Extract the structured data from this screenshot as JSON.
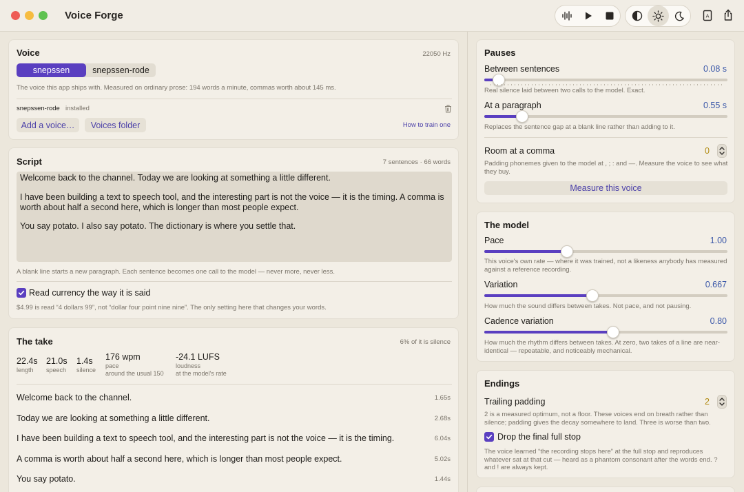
{
  "app": {
    "title": "Voice Forge"
  },
  "toolbar": {
    "icons": [
      "waveform-icon",
      "play-icon",
      "stop-icon",
      "contrast-icon",
      "sun-icon",
      "moon-icon",
      "book-icon",
      "share-icon"
    ]
  },
  "voice": {
    "heading": "Voice",
    "sample_rate": "22050 Hz",
    "options": [
      "snepssen",
      "snepssen-rode"
    ],
    "selected": "snepssen",
    "caption": "The voice this app ships with. Measured on ordinary prose: 194 words a minute, commas worth about 145 ms.",
    "installed_name": "snepssen-rode",
    "installed_status": "installed",
    "add_label": "Add a voice…",
    "folder_label": "Voices folder",
    "train_link": "How to train one"
  },
  "script": {
    "heading": "Script",
    "meta": "7 sentences · 66 words",
    "paragraphs": [
      "Welcome back to the channel. Today we are looking at something a little different.",
      "I have been building a text to speech tool, and the interesting part is not the voice — it is the timing. A comma is worth about half a second here, which is longer than most people expect.",
      "You say potato. I also say potato. The dictionary is where you settle that."
    ],
    "caption": "A blank line starts a new paragraph. Each sentence becomes one call to the model — never more, never less.",
    "currency_label": "Read currency the way it is said",
    "currency_checked": true,
    "currency_caption": "$4.99 is read “4 dollars 99”, not “dollar four point nine nine”. The only setting here that changes your words."
  },
  "take": {
    "heading": "The take",
    "meta": "6% of it is silence",
    "stats": [
      {
        "value": "22.4s",
        "label": "length",
        "sub": ""
      },
      {
        "value": "21.0s",
        "label": "speech",
        "sub": ""
      },
      {
        "value": "1.4s",
        "label": "silence",
        "sub": ""
      },
      {
        "value": "176 wpm",
        "label": "pace",
        "sub": "around the usual 150"
      },
      {
        "value": "-24.1 LUFS",
        "label": "loudness",
        "sub": "at the model's rate"
      }
    ],
    "sentences": [
      {
        "text": "Welcome back to the channel.",
        "dur": "1.65s"
      },
      {
        "text": "Today we are looking at something a little different.",
        "dur": "2.68s"
      },
      {
        "text": "I have been building a text to speech tool, and the interesting part is not the voice — it is the timing.",
        "dur": "6.04s"
      },
      {
        "text": "A comma is worth about half a second here, which is longer than most people expect.",
        "dur": "5.02s"
      },
      {
        "text": "You say potato.",
        "dur": "1.44s"
      }
    ]
  },
  "pauses": {
    "heading": "Pauses",
    "between": {
      "label": "Between sentences",
      "value": "0.08 s",
      "level": 0.06,
      "caption": "Real silence laid between two calls to the model. Exact."
    },
    "paragraph": {
      "label": "At a paragraph",
      "value": "0.55 s",
      "level": 0.155,
      "caption": "Replaces the sentence gap at a blank line rather than adding to it."
    },
    "comma": {
      "label": "Room at a comma",
      "value": "0",
      "caption": "Padding phonemes given to the model at , ; : and —. Measure the voice to see what they buy."
    },
    "measure_label": "Measure this voice"
  },
  "model": {
    "heading": "The model",
    "pace": {
      "label": "Pace",
      "value": "1.00",
      "level": 0.34,
      "caption": "This voice's own rate — where it was trained, not a likeness anybody has measured against a reference recording."
    },
    "variation": {
      "label": "Variation",
      "value": "0.667",
      "level": 0.445,
      "caption": "How much the sound differs between takes. Not pace, and not pausing."
    },
    "cadence": {
      "label": "Cadence variation",
      "value": "0.80",
      "level": 0.53,
      "caption": "How much the rhythm differs between takes. At zero, two takes of a line are near-identical — repeatable, and noticeably mechanical."
    }
  },
  "endings": {
    "heading": "Endings",
    "trailing": {
      "label": "Trailing padding",
      "value": "2",
      "caption": "2 is a measured optimum, not a floor. These voices end on breath rather than silence; padding gives the decay somewhere to land. Three is worse than two."
    },
    "drop_label": "Drop the final full stop",
    "drop_checked": true,
    "drop_caption": "The voice learned “the recording stops here” at the full stop and reproduces whatever sat at that cut — heard as a phantom consonant after the words end. ? and ! are always kept."
  },
  "colors": {
    "accent": "#5a3fc0",
    "value": "#3a57a8",
    "comma_value": "#b08a10"
  }
}
